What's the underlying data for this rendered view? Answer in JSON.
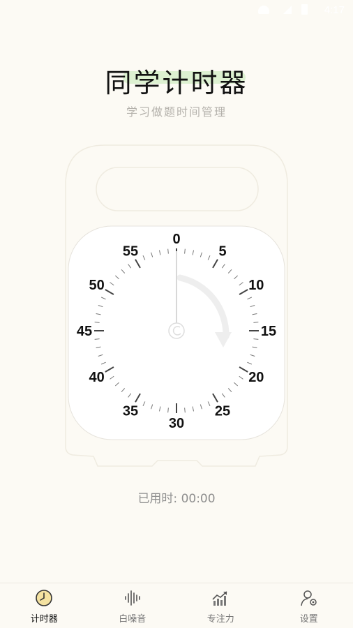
{
  "status_bar": {
    "time": "4:17"
  },
  "header": {
    "title": "同学计时器",
    "subtitle": "学习做题时间管理"
  },
  "timer": {
    "dial_labels": [
      "0",
      "5",
      "10",
      "15",
      "20",
      "25",
      "30",
      "35",
      "40",
      "45",
      "50",
      "55"
    ],
    "progress_minutes": 0,
    "elapsed_text": "已用时: 00:00"
  },
  "nav": {
    "items": [
      {
        "label": "计时器",
        "icon": "clock-icon",
        "active": true
      },
      {
        "label": "白噪音",
        "icon": "soundwave-icon",
        "active": false
      },
      {
        "label": "专注力",
        "icon": "chart-icon",
        "active": false
      },
      {
        "label": "设置",
        "icon": "settings-person-icon",
        "active": false
      }
    ]
  },
  "colors": {
    "background": "#fcfaf4",
    "title_highlight": "#d9efcd",
    "clock_icon_fill": "#f4e2a1"
  }
}
